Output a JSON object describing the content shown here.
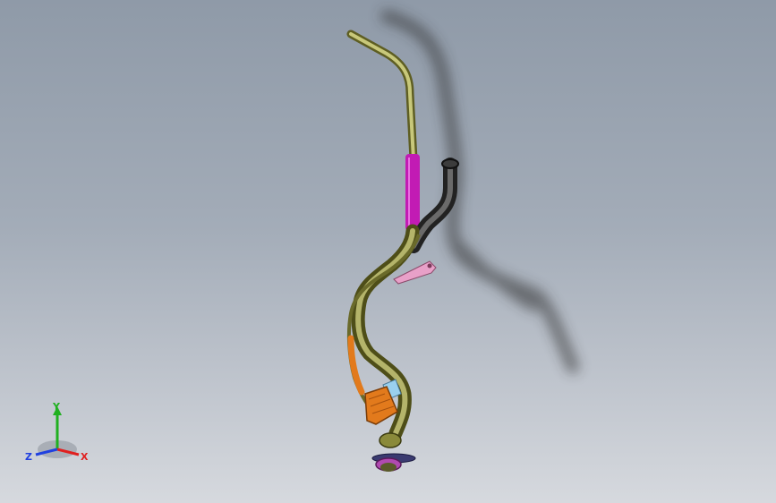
{
  "viewport": {
    "background_top": "#8f9aa8",
    "background_bottom": "#d6d9de"
  },
  "model": {
    "tube_color": "#8a8a3a",
    "tube_highlight": "#c8c87a",
    "sleeve_color": "#c21bb4",
    "hose_color": "#3c3c3c",
    "bracket_color": "#e8a0c8",
    "accent_orange": "#e27a1c",
    "accent_blue": "#9ad0ee",
    "shadow_color": "#2e2e2e"
  },
  "triad": {
    "x_label": "X",
    "y_label": "Y",
    "z_label": "Z",
    "x_color": "#e02020",
    "y_color": "#20b020",
    "z_color": "#2040e0"
  }
}
